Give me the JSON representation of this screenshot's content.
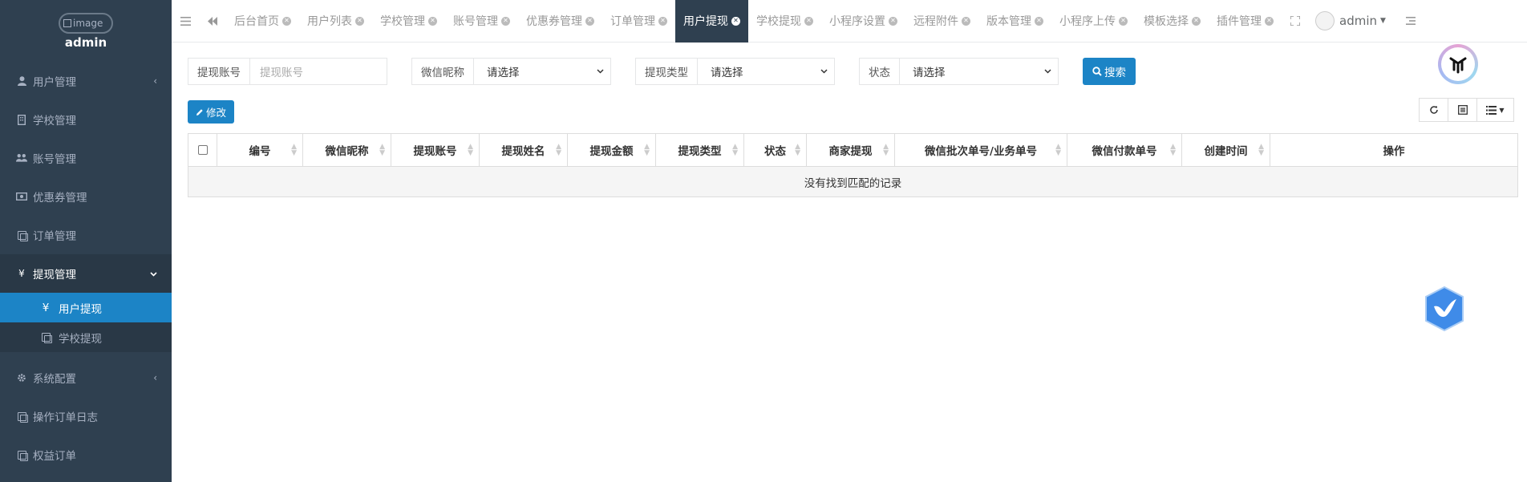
{
  "sidebar": {
    "logo_alt": "image",
    "username": "admin",
    "items": [
      {
        "label": "用户管理",
        "icon": "user-icon",
        "arrow": "‹"
      },
      {
        "label": "学校管理",
        "icon": "school-icon",
        "arrow": ""
      },
      {
        "label": "账号管理",
        "icon": "users-icon",
        "arrow": ""
      },
      {
        "label": "优惠券管理",
        "icon": "coupon-icon",
        "arrow": ""
      },
      {
        "label": "订单管理",
        "icon": "copy-icon",
        "arrow": ""
      },
      {
        "label": "提现管理",
        "icon": "yen-icon",
        "arrow": "⌄"
      }
    ],
    "sub_items": [
      {
        "label": "用户提现",
        "icon": "yen-icon"
      },
      {
        "label": "学校提现",
        "icon": "copy-icon"
      }
    ],
    "bottom_items": [
      {
        "label": "系统配置",
        "icon": "gear-icon",
        "arrow": "‹"
      },
      {
        "label": "操作订单日志",
        "icon": "copy-icon"
      },
      {
        "label": "权益订单",
        "icon": "copy-icon"
      }
    ]
  },
  "topbar": {
    "tabs": [
      "后台首页",
      "用户列表",
      "学校管理",
      "账号管理",
      "优惠券管理",
      "订单管理",
      "用户提现",
      "学校提现",
      "小程序设置",
      "远程附件",
      "版本管理",
      "小程序上传",
      "模板选择",
      "插件管理"
    ],
    "active_tab": "用户提现",
    "user": "admin"
  },
  "filters": {
    "account_label": "提现账号",
    "account_placeholder": "提现账号",
    "nickname_label": "微信昵称",
    "nickname_value": "请选择",
    "type_label": "提现类型",
    "type_value": "请选择",
    "status_label": "状态",
    "status_value": "请选择",
    "search_label": "搜索"
  },
  "toolbar": {
    "edit_label": "修改"
  },
  "table": {
    "columns": [
      "编号",
      "微信昵称",
      "提现账号",
      "提现姓名",
      "提现金额",
      "提现类型",
      "状态",
      "商家提现",
      "微信批次单号/业务单号",
      "微信付款单号",
      "创建时间",
      "操作"
    ],
    "empty_text": "没有找到匹配的记录"
  },
  "colors": {
    "sidebar_bg": "#2f4050",
    "accent": "#1c84c6"
  }
}
